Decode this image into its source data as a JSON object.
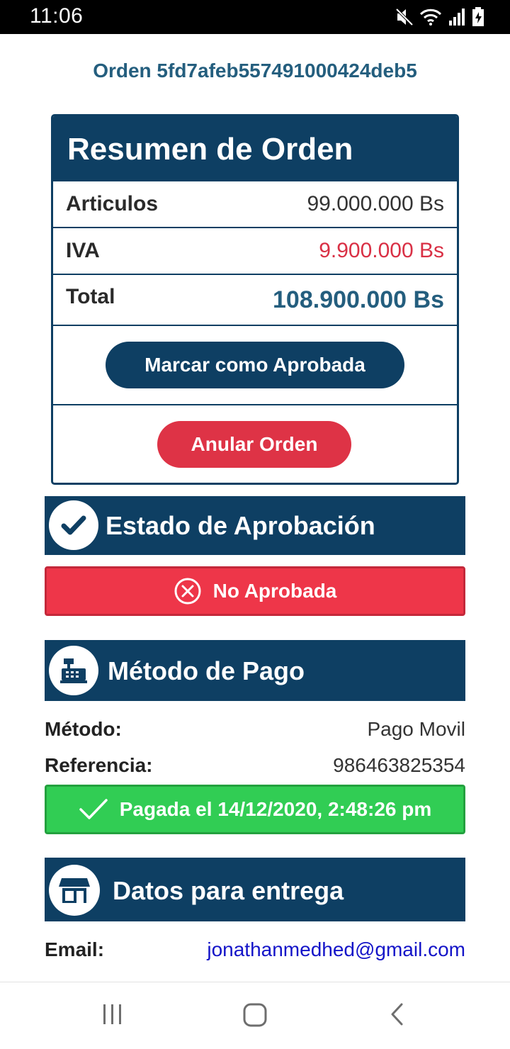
{
  "status_bar": {
    "time": "11:06"
  },
  "order": {
    "title": "Orden 5fd7afeb557491000424deb5"
  },
  "summary": {
    "heading": "Resumen de Orden",
    "items_label": "Articulos",
    "items_value": "99.000.000 Bs",
    "tax_label": "IVA",
    "tax_value": "9.900.000 Bs",
    "tax_color": "#d93045",
    "total_label": "Total",
    "total_value": "108.900.000 Bs",
    "approve_button": "Marcar como Aprobada",
    "cancel_button": "Anular Orden"
  },
  "approval": {
    "heading": "Estado de Aprobación",
    "status_text": "No Aprobada",
    "icon": "check-icon",
    "status_icon": "x-circle-icon"
  },
  "payment": {
    "heading": "Método de Pago",
    "icon": "cash-register-icon",
    "method_label": "Método:",
    "method_value": "Pago Movil",
    "reference_label": "Referencia:",
    "reference_value": "986463825354",
    "paid_text": "Pagada el 14/12/2020, 2:48:26 pm",
    "paid_icon": "check-icon"
  },
  "delivery": {
    "heading": "Datos para entrega",
    "icon": "store-icon",
    "email_label": "Email:",
    "email_value": "jonathanmedhed@gmail.com"
  },
  "colors": {
    "primary": "#0e3f63",
    "accent_text": "#245e7e",
    "danger": "#de3346",
    "success": "#31cd54"
  }
}
